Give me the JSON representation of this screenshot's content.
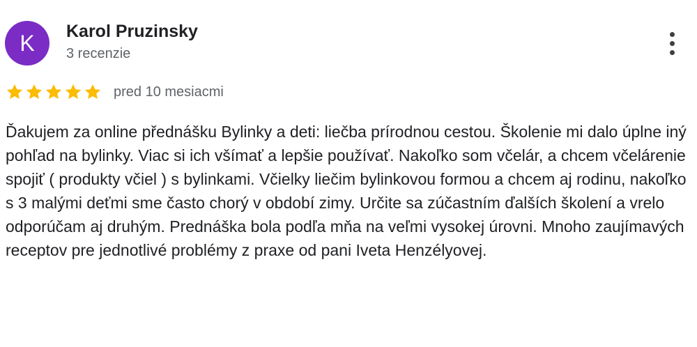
{
  "review": {
    "avatar": {
      "initial": "K",
      "color": "#7b2cc4"
    },
    "author_name": "Karol Pruzinsky",
    "review_count": "3 recenzie",
    "more_icon": "more-vert-icon",
    "rating": {
      "stars": 5,
      "max_stars": 5,
      "star_icon": "star-icon",
      "star_color": "#fbbc04"
    },
    "date": "pred 10 mesiacmi",
    "text": "Ďakujem za online přednášku Bylinky a deti: liečba prírodnou cestou. Školenie mi dalo úplne iný pohľad na bylinky. Viac si ich všímať a lepšie používať. Nakoľko som včelár, a chcem včelárenie spojiť ( produkty včiel ) s bylinkami. Včielky liečim bylinkovou formou a chcem aj rodinu, nakoľko s 3 malými deťmi sme často chorý v období zimy. Určite sa zúčastním ďalších školení a vrelo odporúčam aj druhým. Prednáška bola podľa mňa na veľmi vysokej úrovni. Mnoho zaujímavých receptov pre jednotlivé problémy z praxe od pani Iveta Henzélyovej."
  }
}
